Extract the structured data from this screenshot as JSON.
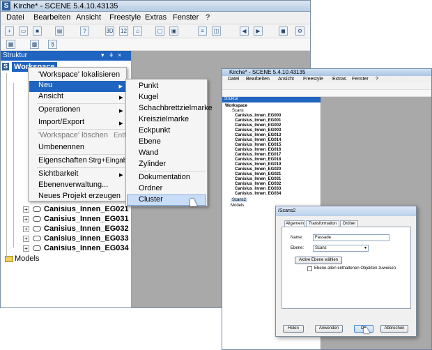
{
  "app": {
    "title": "Kirche* - SCENE 5.4.10.43135",
    "menus": [
      "Datei",
      "Bearbeiten",
      "Ansicht",
      "Freestyle",
      "Extras",
      "Fenster",
      "?"
    ],
    "toolbar_labels": [
      "3D",
      "12"
    ],
    "colors": {
      "titlebar": "#b7cbe3",
      "selection": "#1f64c0",
      "panel_gray": "#a9a9a9"
    }
  },
  "structure": {
    "title": "Struktur",
    "workspace": "Workspace",
    "items": [
      "Canisius_Innen_EG021",
      "Canisius_Innen_EG031",
      "Canisius_Innen_EG032",
      "Canisius_Innen_EG033",
      "Canisius_Innen_EG034"
    ],
    "models": "Models"
  },
  "context_menu": {
    "items": [
      "'Workspace' lokalisieren",
      "Neu",
      "Ansicht",
      "Operationen",
      "Import/Export",
      "'Workspace' löschen",
      "Umbenennen",
      "Eigenschaften",
      "Sichtbarkeit",
      "Ebenenverwaltung...",
      "Neues Projekt erzeugen"
    ],
    "shortcuts": {
      "loeschen": "Entf",
      "eigenschaften": "Strg+Eingabe"
    }
  },
  "submenu": {
    "items": [
      "Punkt",
      "Kugel",
      "Schachbrettzielmarke",
      "Kreiszielmarke",
      "Eckpunkt",
      "Ebene",
      "Wand",
      "Zylinder",
      "Dokumentation",
      "Ordner",
      "Cluster"
    ],
    "hovered": "Cluster"
  },
  "window2": {
    "title": "Kirche* - SCENE 5.4.10.43135",
    "menus": [
      "Datei",
      "Bearbeiten",
      "Ansicht",
      "Freestyle",
      "Extras",
      "Fenster",
      "?"
    ],
    "panel_title": "Struktur",
    "workspace": "Workspace",
    "scans": "Scans",
    "items": [
      "Canisius_Innen_EG000",
      "Canisius_Innen_EG001",
      "Canisius_Innen_EG002",
      "Canisius_Innen_EG003",
      "Canisius_Innen_EG013",
      "Canisius_Innen_EG014",
      "Canisius_Innen_EG015",
      "Canisius_Innen_EG016",
      "Canisius_Innen_EG017",
      "Canisius_Innen_EG018",
      "Canisius_Innen_EG019",
      "Canisius_Innen_EG020",
      "Canisius_Innen_EG021",
      "Canisius_Innen_EG031",
      "Canisius_Innen_EG032",
      "Canisius_Innen_EG033",
      "Canisius_Innen_EG034"
    ],
    "scans2": "Scans2",
    "models": "Models"
  },
  "dialog": {
    "title": "/Scans2",
    "tabs": [
      "Allgemein",
      "Transformation",
      "Ordner"
    ],
    "name_label": "Name:",
    "name_value": "Fassade",
    "layer_label": "Ebene:",
    "layer_value": "Scans",
    "choose_button": "Aktive Ebene wählen",
    "checkbox_label": "Ebene allen enthaltenen Objekten zuweisen",
    "buttons": {
      "load": "Holen",
      "apply": "Anwenden",
      "ok": "OK",
      "cancel": "Abbrechen"
    }
  }
}
